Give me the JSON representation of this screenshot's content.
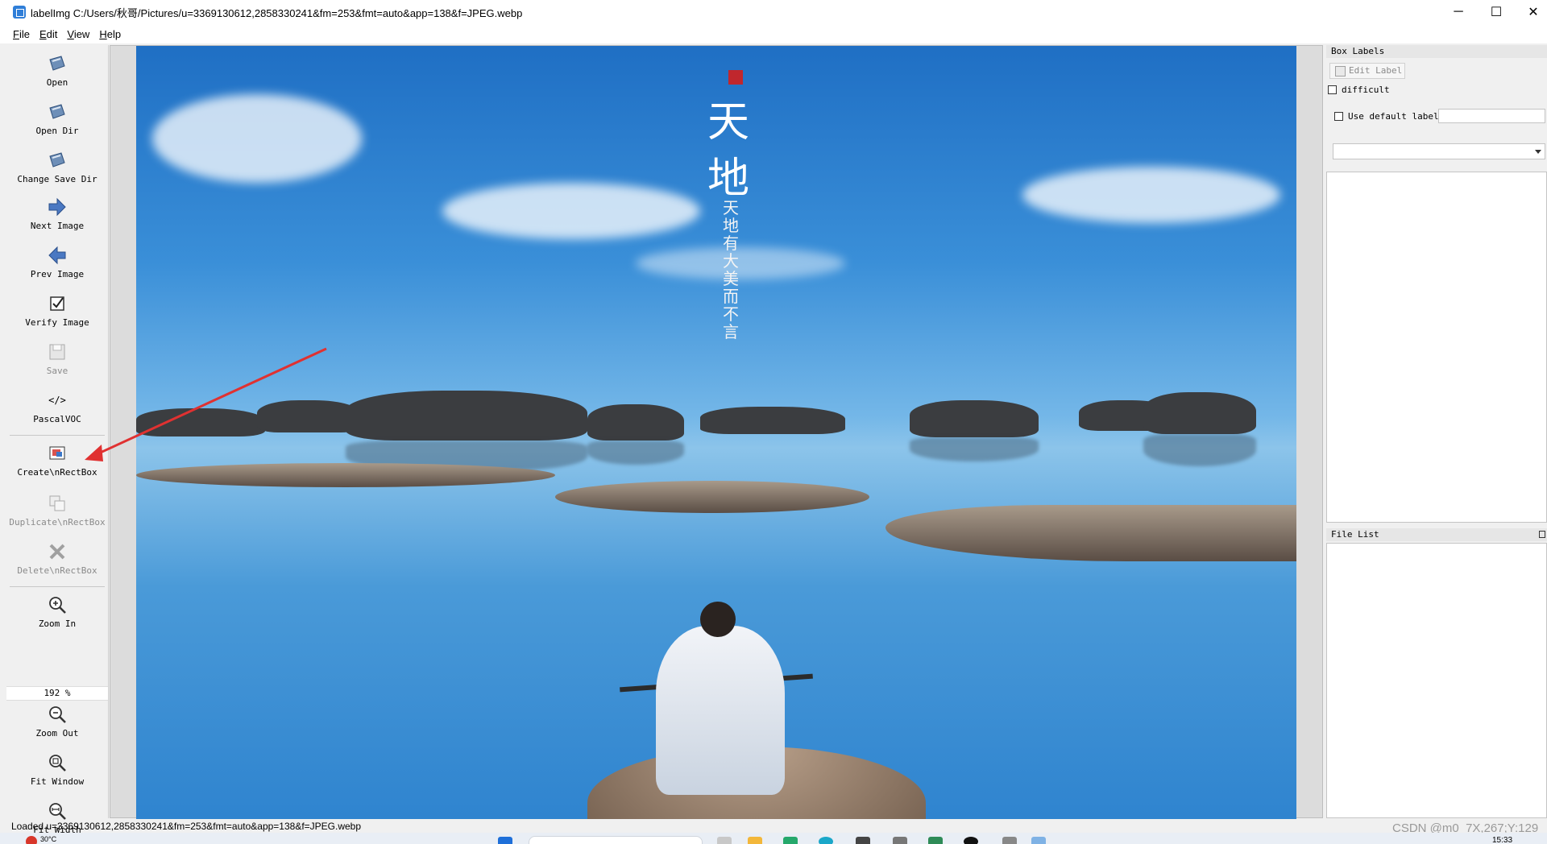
{
  "window": {
    "title": "labelImg C:/Users/秋哥/Pictures/u=3369130612,2858330241&fm=253&fmt=auto&app=138&f=JPEG.webp",
    "minimize_icon": "─",
    "maximize_icon": "☐",
    "close_icon": "✕"
  },
  "menu": {
    "file": "File",
    "edit": "Edit",
    "view": "View",
    "help": "Help"
  },
  "toolbar": {
    "open": "Open",
    "open_dir": "Open Dir",
    "change_save_dir": "Change Save Dir",
    "next_image": "Next Image",
    "prev_image": "Prev Image",
    "verify_image": "Verify Image",
    "save": "Save",
    "format_icon": "</>",
    "format": "PascalVOC",
    "create_rectbox": "Create\\nRectBox",
    "duplicate_rectbox": "Duplicate\\nRectBox",
    "delete_rectbox": "Delete\\nRectBox",
    "zoom_in": "Zoom In",
    "zoom_value": "192 %",
    "zoom_out": "Zoom Out",
    "fit_window": "Fit Window",
    "fit_width": "Fit Width"
  },
  "image": {
    "calligraphy": "天\n地",
    "vertical_text": "天地有大美而不言"
  },
  "box_labels": {
    "title": "Box Labels",
    "edit_label": "Edit Label",
    "difficult": "difficult",
    "use_default_label": "Use default label",
    "default_label_value": ""
  },
  "file_list": {
    "title": "File List"
  },
  "status": {
    "message": "Loaded u=3369130612,2858330241&fm=253&fmt=auto&app=138&f=JPEG.webp",
    "watermark": "CSDN @m0_7X,267;Y:129"
  },
  "taskbar": {
    "weather": "30°C",
    "clock": "15:33"
  },
  "colors": {
    "accent_blue": "#2f7ed8",
    "arrow_red": "#e03131",
    "disabled_text": "#8a8a8a"
  }
}
